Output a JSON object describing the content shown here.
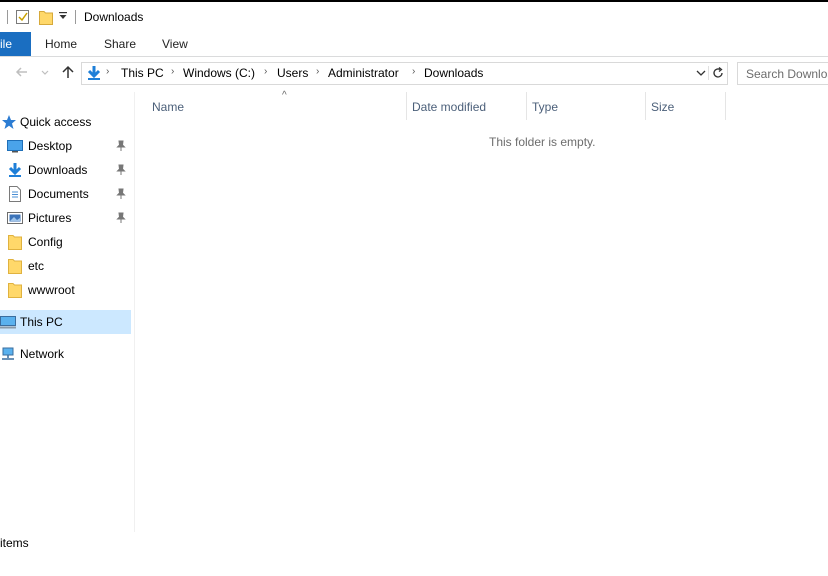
{
  "window": {
    "title": "Downloads"
  },
  "ribbon": {
    "tabs": {
      "file": "ile",
      "home": "Home",
      "share": "Share",
      "view": "View"
    }
  },
  "address": {
    "crumbs": [
      "This PC",
      "Windows (C:)",
      "Users",
      "Administrator",
      "Downloads"
    ],
    "search_placeholder": "Search Downloads"
  },
  "nav": {
    "quick_access": "Quick access",
    "pinned": [
      "Desktop",
      "Downloads",
      "Documents",
      "Pictures"
    ],
    "folders": [
      "Config",
      "etc",
      "wwwroot"
    ],
    "this_pc": "This PC",
    "network": "Network"
  },
  "columns": {
    "name": "Name",
    "date_modified": "Date modified",
    "type": "Type",
    "size": "Size"
  },
  "content": {
    "empty_message": "This folder is empty."
  },
  "status": {
    "text": "items"
  },
  "colors": {
    "accent": "#1a6ec1",
    "selection": "#cce8ff",
    "header_text": "#4c607a"
  }
}
